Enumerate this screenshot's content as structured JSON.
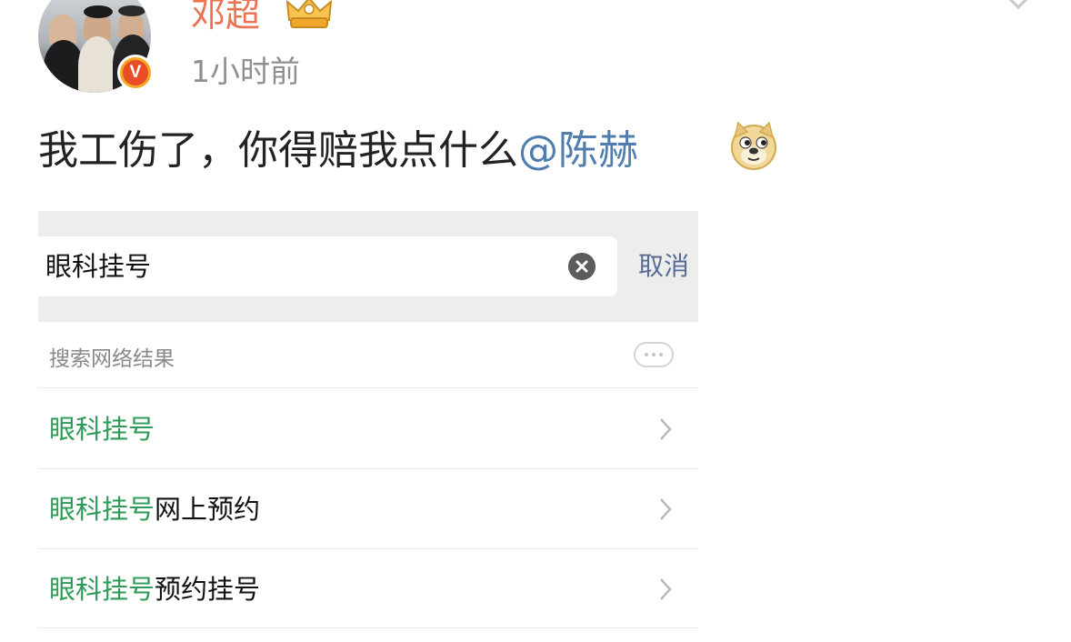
{
  "post": {
    "username": "邓超",
    "timestamp": "1小时前",
    "text_before_mention": "我工伤了，你得赔我点什么",
    "mention": "@陈赫",
    "icons": {
      "avatar": "avatar-photo",
      "verified_badge": "verified-v-badge",
      "member_badge": "crown-member-icon",
      "emoji": "doge-emoji",
      "menu": "chevron-down-icon"
    }
  },
  "screenshot": {
    "search": {
      "value": "眼科挂号",
      "cancel_label": "取消"
    },
    "section_title": "搜索网络结果",
    "results": [
      {
        "highlight": "眼科挂号",
        "rest": ""
      },
      {
        "highlight": "眼科挂号",
        "rest": "网上预约"
      },
      {
        "highlight": "眼科挂号",
        "rest": "预约挂号"
      }
    ]
  },
  "colors": {
    "username": "#eb7350",
    "mention": "#507daf",
    "highlight": "#2b9b55",
    "cancel": "#576b95",
    "timestamp": "#8f8f8f"
  }
}
